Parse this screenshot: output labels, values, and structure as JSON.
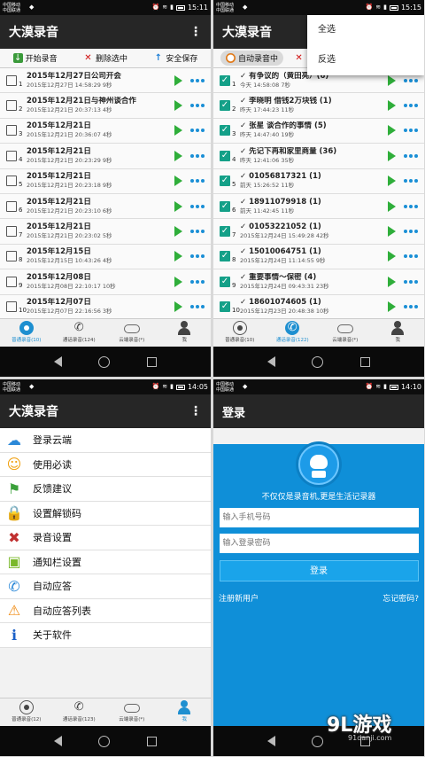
{
  "app_title": "大漠录音",
  "status_bars": [
    {
      "carrier1": "中国移动",
      "carrier2": "中国联通",
      "time": "15:11"
    },
    {
      "carrier1": "中国移动",
      "carrier2": "中国联通",
      "time": "15:15"
    },
    {
      "carrier1": "中国移动",
      "carrier2": "中国联通",
      "time": "14:05"
    },
    {
      "carrier1": "中国移动",
      "carrier2": "中国联通",
      "time": "14:10"
    }
  ],
  "screen1": {
    "toolbar": {
      "start": "开始录音",
      "delete": "删除选中",
      "save": "安全保存"
    },
    "recordings": [
      {
        "num": "1",
        "title": "2015年12月27日公司开会",
        "meta": "2015年12月27日 14:58:29 9秒"
      },
      {
        "num": "2",
        "title": "2015年12月21日与神州谈合作",
        "meta": "2015年12月21日 20:37:13 4秒"
      },
      {
        "num": "3",
        "title": "2015年12月21日",
        "meta": "2015年12月21日 20:36:07 4秒"
      },
      {
        "num": "4",
        "title": "2015年12月21日",
        "meta": "2015年12月21日 20:23:29 9秒"
      },
      {
        "num": "5",
        "title": "2015年12月21日",
        "meta": "2015年12月21日 20:23:18 9秒"
      },
      {
        "num": "6",
        "title": "2015年12月21日",
        "meta": "2015年12月21日 20:23:10 6秒"
      },
      {
        "num": "7",
        "title": "2015年12月21日",
        "meta": "2015年12月21日 20:23:02 5秒"
      },
      {
        "num": "8",
        "title": "2015年12月15日",
        "meta": "2015年12月15日 10:43:26 4秒"
      },
      {
        "num": "9",
        "title": "2015年12月08日",
        "meta": "2015年12月08日 22:10:17 10秒"
      },
      {
        "num": "10",
        "title": "2015年12月07日",
        "meta": "2015年12月07日 22:16:56 3秒"
      }
    ],
    "nav": [
      "普通录音(10)",
      "通话录音(124)",
      "云端录音(*)",
      "我"
    ]
  },
  "screen2": {
    "toolbar": {
      "auto": "自动录音中"
    },
    "menu": [
      "全选",
      "反选"
    ],
    "calls": [
      {
        "num": "1",
        "title": "✓ 有争议的（黄田亮）(6)",
        "meta": "今天 14:58:08 7秒"
      },
      {
        "num": "2",
        "title": "✓ 李晓明 借钱2万块钱 (1)",
        "meta": "昨天 17:44:23 11秒"
      },
      {
        "num": "3",
        "title": "✓ 张星 谈合作的事情 (5)",
        "meta": "昨天 14:47:40 19秒"
      },
      {
        "num": "4",
        "title": "✓ 先记下再和家里商量 (36)",
        "meta": "昨天 12:41:06 35秒"
      },
      {
        "num": "5",
        "title": "✓ 01056817321 (1)",
        "meta": "前天 15:26:52 11秒"
      },
      {
        "num": "6",
        "title": "✓ 18911079918 (1)",
        "meta": "前天 11:42:45 11秒"
      },
      {
        "num": "7",
        "title": "✓ 01053221052 (1)",
        "meta": "2015年12月24日 15:49:28 42秒"
      },
      {
        "num": "8",
        "title": "✓ 15010064751 (1)",
        "meta": "2015年12月24日 11:14:55 9秒"
      },
      {
        "num": "9",
        "title": "✓ 重要事情～保密 (4)",
        "meta": "2015年12月24日 09:43:31 23秒"
      },
      {
        "num": "10",
        "title": "✓ 18601074605 (1)",
        "meta": "2015年12月23日 20:48:38 10秒"
      }
    ],
    "nav": [
      "普通录音(10)",
      "通话录音(122)",
      "云端录音(*)",
      "我"
    ]
  },
  "screen3": {
    "menu_items": [
      {
        "icon": "cloud-icon",
        "label": "登录云端"
      },
      {
        "icon": "smiley-icon",
        "label": "使用必读"
      },
      {
        "icon": "flag-icon",
        "label": "反馈建议"
      },
      {
        "icon": "lock-icon",
        "label": "设置解锁码"
      },
      {
        "icon": "tools-icon",
        "label": "录音设置"
      },
      {
        "icon": "android-icon",
        "label": "通知栏设置"
      },
      {
        "icon": "phone-icon",
        "label": "自动应答"
      },
      {
        "icon": "warning-icon",
        "label": "自动应答列表"
      },
      {
        "icon": "info-icon",
        "label": "关于软件"
      }
    ],
    "nav": [
      "普通录音(12)",
      "通话录音(123)",
      "云端录音(*)",
      "我"
    ]
  },
  "screen4": {
    "title": "登录",
    "slogan": "不仅仅是录音机,更是生活记录器",
    "phone_placeholder": "输入手机号码",
    "password_placeholder": "输入登录密码",
    "login_button": "登录",
    "register": "注册新用户",
    "forgot": "忘记密码?"
  },
  "watermark": {
    "text": "9L游戏",
    "sub": "91danji.com"
  },
  "colors": {
    "accent": "#1e8fd0",
    "play": "#2fae3a",
    "check": "#14a088",
    "login_bg": "#0f8fd8"
  }
}
